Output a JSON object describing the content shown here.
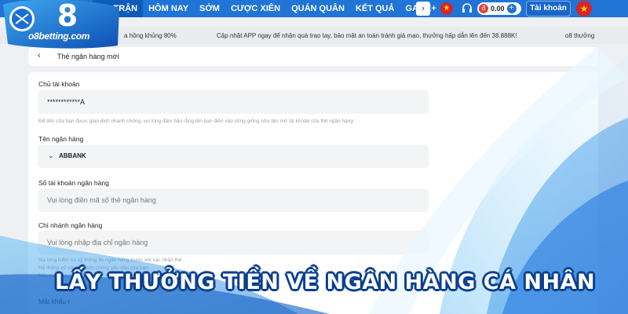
{
  "brand": {
    "logo_text": "o8betting.com",
    "logo_mark": "8"
  },
  "nav": {
    "items": [
      "NG TRẬN",
      "HÔM NAY",
      "SỚM",
      "CƯỢC XIÊN",
      "QUÁN QUÂN",
      "KẾT QUẢ",
      "GAME+"
    ],
    "arrow": "›",
    "balance": "0.00",
    "coin": "đ",
    "plus": "+",
    "account_label": "Tài khoản"
  },
  "marquee": {
    "left": "a hồng khủng 80%",
    "middle": "Cập nhật APP ngay để nhận quà trao tay, bảo mật an toàn tránh giả mạo, thưởng hấp dẫn lên đến 38.888K!",
    "right": "o8 thưởng"
  },
  "panel": {
    "back": "‹",
    "title": "Thẻ ngân hàng mới"
  },
  "form": {
    "holder_label": "Chủ tài khoản",
    "holder_value": "************A",
    "holder_hint": "Để tiền của bạn được giao dịch nhanh chóng, vui lòng đảm bảo rằng tên bạn điền vào cũng giống như tên mở tài khoản của thẻ ngân hàng",
    "bank_label": "Tên ngân hàng",
    "bank_value": "ABBANK",
    "account_no_label": "Số tài khoản ngân hàng",
    "account_no_placeholder": "Vui lòng điền mã số thẻ ngân hàng",
    "branch_label": "Chi nhánh ngân hàng",
    "branch_placeholder": "Vui lòng nhập địa chỉ ngân hàng",
    "branch_hint_1": "Vui lòng kiểm tra kỹ thông tin ngân hàng trước khi xác nhận thẻ",
    "branch_hint_2": "Hệ thống sẽ xử lý nhanh chóng yêu cầu của bạn",
    "branch_hint_3": "Nếu quý khách cần hỗ trợ",
    "password_label": "Mật khẩu r"
  },
  "caption": "LẤY THƯỞNG TIỀN VỀ NGÂN HÀNG CÁ NHÂN",
  "colors": {
    "nav_blue": "#1f74d6",
    "account_button": "#1766c8",
    "caption_outline": "#0b3f8f"
  }
}
